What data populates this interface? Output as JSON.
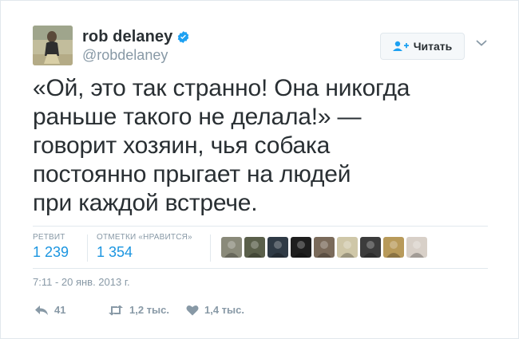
{
  "user": {
    "name": "rob delaney",
    "handle": "@robdelaney",
    "verified": true
  },
  "follow_button": {
    "label": "Читать",
    "icon": "follow-user-icon"
  },
  "tweet": {
    "text": "«Ой, это так странно! Она никогда\nраньше такого не делала!» —\nговорит хозяин, чья собака\nпостоянно прыгает на людей\nпри каждой встрече."
  },
  "stats": {
    "retweets_label": "РЕТВИТ",
    "retweets_value": "1 239",
    "likes_label": "ОТМЕТКИ «НРАВИТСЯ»",
    "likes_value": "1 354"
  },
  "likers": [
    {
      "color": "#8a8a7a"
    },
    {
      "color": "#5a5f4a"
    },
    {
      "color": "#2f3a45"
    },
    {
      "color": "#1e1e1e"
    },
    {
      "color": "#7a6a5a"
    },
    {
      "color": "#cfc7a8"
    },
    {
      "color": "#3c3c3c"
    },
    {
      "color": "#b89a5a"
    },
    {
      "color": "#d8d0c8"
    }
  ],
  "timestamp": "7:11 - 20 янв. 2013 г.",
  "actions": {
    "reply_count": "41",
    "retweet_count": "1,2 тыс.",
    "like_count": "1,4 тыс."
  },
  "colors": {
    "accent": "#1b95e0",
    "muted": "#8899a6",
    "text": "#292f33",
    "border": "#e1e8ed"
  }
}
